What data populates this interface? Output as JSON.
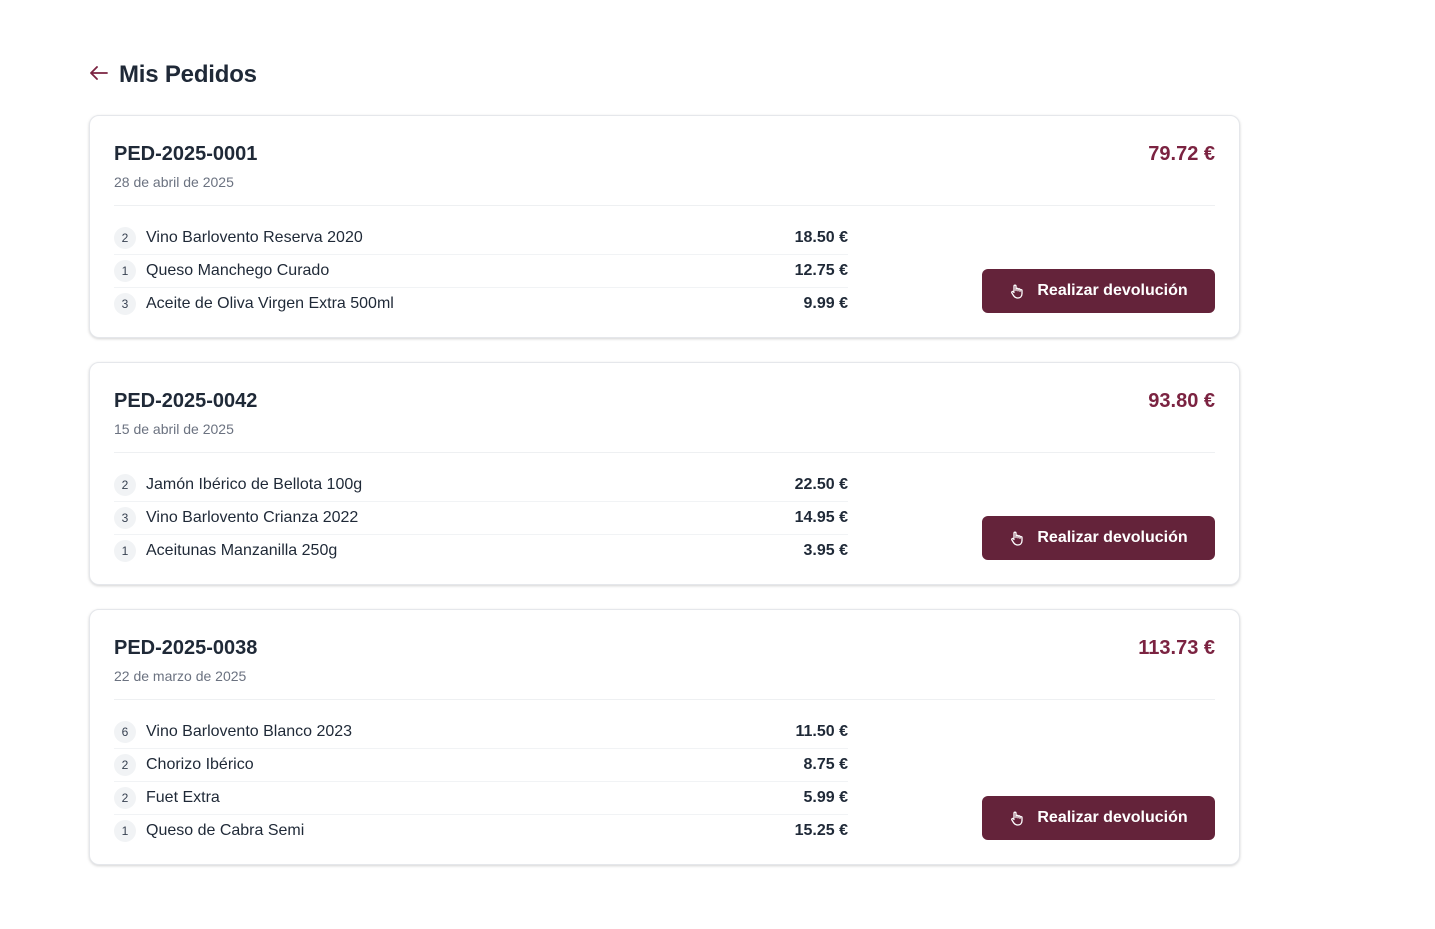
{
  "page": {
    "title": "Mis Pedidos",
    "back_icon": "arrow-left-icon"
  },
  "colors": {
    "accent": "#7b2341",
    "button_bg": "#64233a",
    "text": "#1f2937",
    "muted": "#6b7280"
  },
  "orders": [
    {
      "id": "PED-2025-0001",
      "date": "28 de abril de 2025",
      "total": "79.72 €",
      "items": [
        {
          "qty": "2",
          "name": "Vino Barlovento Reserva 2020",
          "price": "18.50 €"
        },
        {
          "qty": "1",
          "name": "Queso Manchego Curado",
          "price": "12.75 €"
        },
        {
          "qty": "3",
          "name": "Aceite de Oliva Virgen Extra 500ml",
          "price": "9.99 €"
        }
      ],
      "return_label": "Realizar devolución"
    },
    {
      "id": "PED-2025-0042",
      "date": "15 de abril de 2025",
      "total": "93.80 €",
      "items": [
        {
          "qty": "2",
          "name": "Jamón Ibérico de Bellota 100g",
          "price": "22.50 €"
        },
        {
          "qty": "3",
          "name": "Vino Barlovento Crianza 2022",
          "price": "14.95 €"
        },
        {
          "qty": "1",
          "name": "Aceitunas Manzanilla 250g",
          "price": "3.95 €"
        }
      ],
      "return_label": "Realizar devolución"
    },
    {
      "id": "PED-2025-0038",
      "date": "22 de marzo de 2025",
      "total": "113.73 €",
      "items": [
        {
          "qty": "6",
          "name": "Vino Barlovento Blanco 2023",
          "price": "11.50 €"
        },
        {
          "qty": "2",
          "name": "Chorizo Ibérico",
          "price": "8.75 €"
        },
        {
          "qty": "2",
          "name": "Fuet Extra",
          "price": "5.99 €"
        },
        {
          "qty": "1",
          "name": "Queso de Cabra Semi",
          "price": "15.25 €"
        }
      ],
      "return_label": "Realizar devolución"
    }
  ]
}
